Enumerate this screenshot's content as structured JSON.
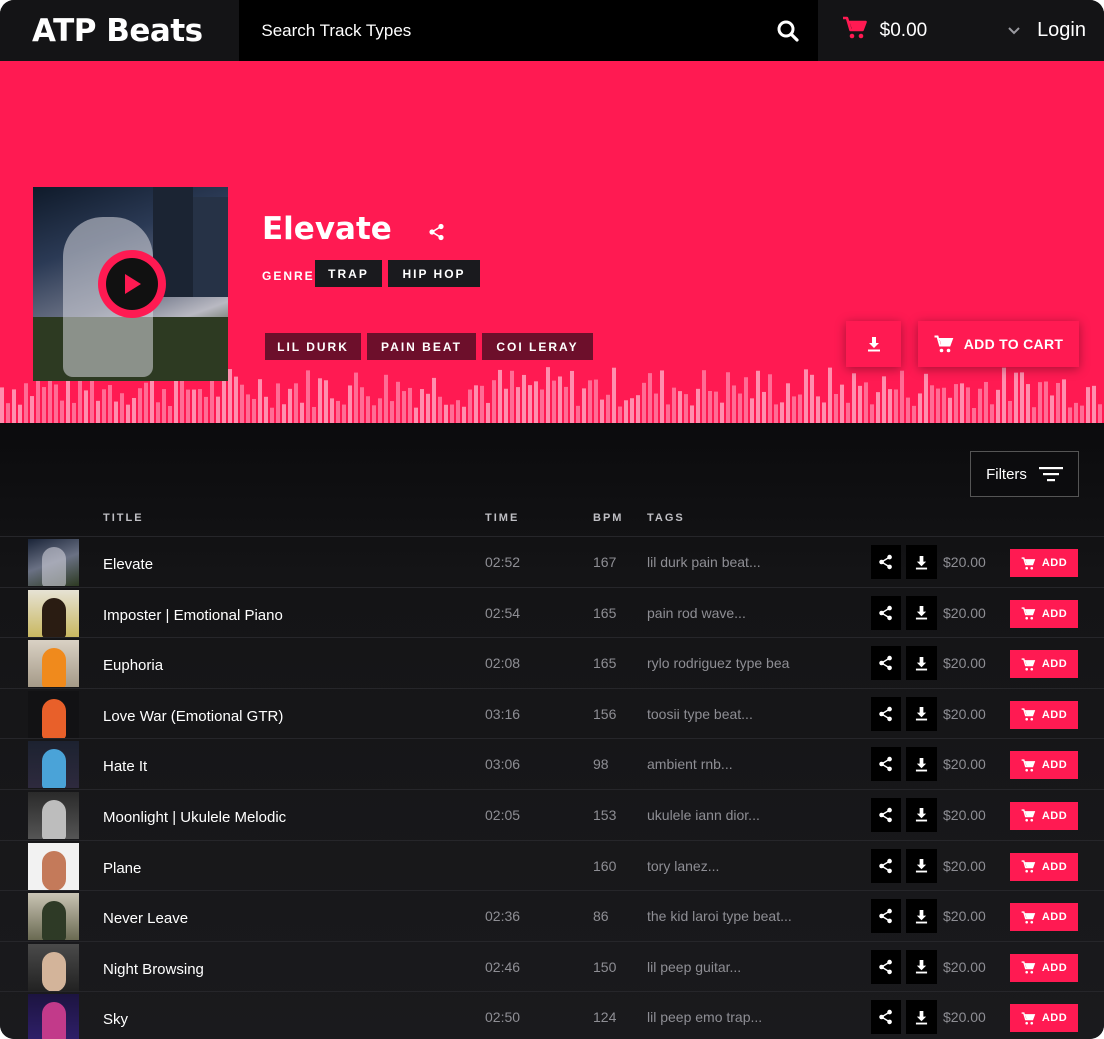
{
  "header": {
    "logo": "ATP Beats",
    "search_placeholder": "Search Track Types",
    "cart_total": "$0.00",
    "login_label": "Login",
    "icons": {
      "search": "search-icon",
      "cart": "cart-icon",
      "dropdown": "chevron-down-icon"
    }
  },
  "hero": {
    "title": "Elevate",
    "genre_label": "GENRE",
    "genres": [
      "TRAP",
      "HIP HOP"
    ],
    "artist_tags": [
      "LIL DURK",
      "PAIN BEAT",
      "COI LERAY"
    ],
    "add_to_cart_label": "ADD TO CART",
    "accent_color": "#ff1a52"
  },
  "list": {
    "filters_label": "Filters",
    "columns": {
      "title": "TITLE",
      "time": "TIME",
      "bpm": "BPM",
      "tags": "TAGS"
    },
    "add_label": "ADD",
    "tracks": [
      {
        "title": "Elevate",
        "time": "02:52",
        "bpm": "167",
        "tags": "lil durk  pain beat...",
        "price": "$20.00"
      },
      {
        "title": "Imposter | Emotional Piano",
        "time": "02:54",
        "bpm": "165",
        "tags": "pain  rod wave...",
        "price": "$20.00"
      },
      {
        "title": "Euphoria",
        "time": "02:08",
        "bpm": "165",
        "tags": "rylo rodriguez type bea",
        "price": "$20.00"
      },
      {
        "title": "Love War (Emotional GTR)",
        "time": "03:16",
        "bpm": "156",
        "tags": "toosii type beat...",
        "price": "$20.00"
      },
      {
        "title": "Hate It",
        "time": "03:06",
        "bpm": "98",
        "tags": "ambient rnb...",
        "price": "$20.00"
      },
      {
        "title": "Moonlight | Ukulele Melodic",
        "time": "02:05",
        "bpm": "153",
        "tags": "ukulele  iann dior...",
        "price": "$20.00"
      },
      {
        "title": "Plane",
        "time": "",
        "bpm": "160",
        "tags": "tory lanez...",
        "price": "$20.00"
      },
      {
        "title": "Never Leave",
        "time": "02:36",
        "bpm": "86",
        "tags": "the kid laroi type beat...",
        "price": "$20.00"
      },
      {
        "title": "Night Browsing",
        "time": "02:46",
        "bpm": "150",
        "tags": "lil peep guitar...",
        "price": "$20.00"
      },
      {
        "title": "Sky",
        "time": "02:50",
        "bpm": "124",
        "tags": "lil peep  emo trap...",
        "price": "$20.00"
      }
    ]
  }
}
